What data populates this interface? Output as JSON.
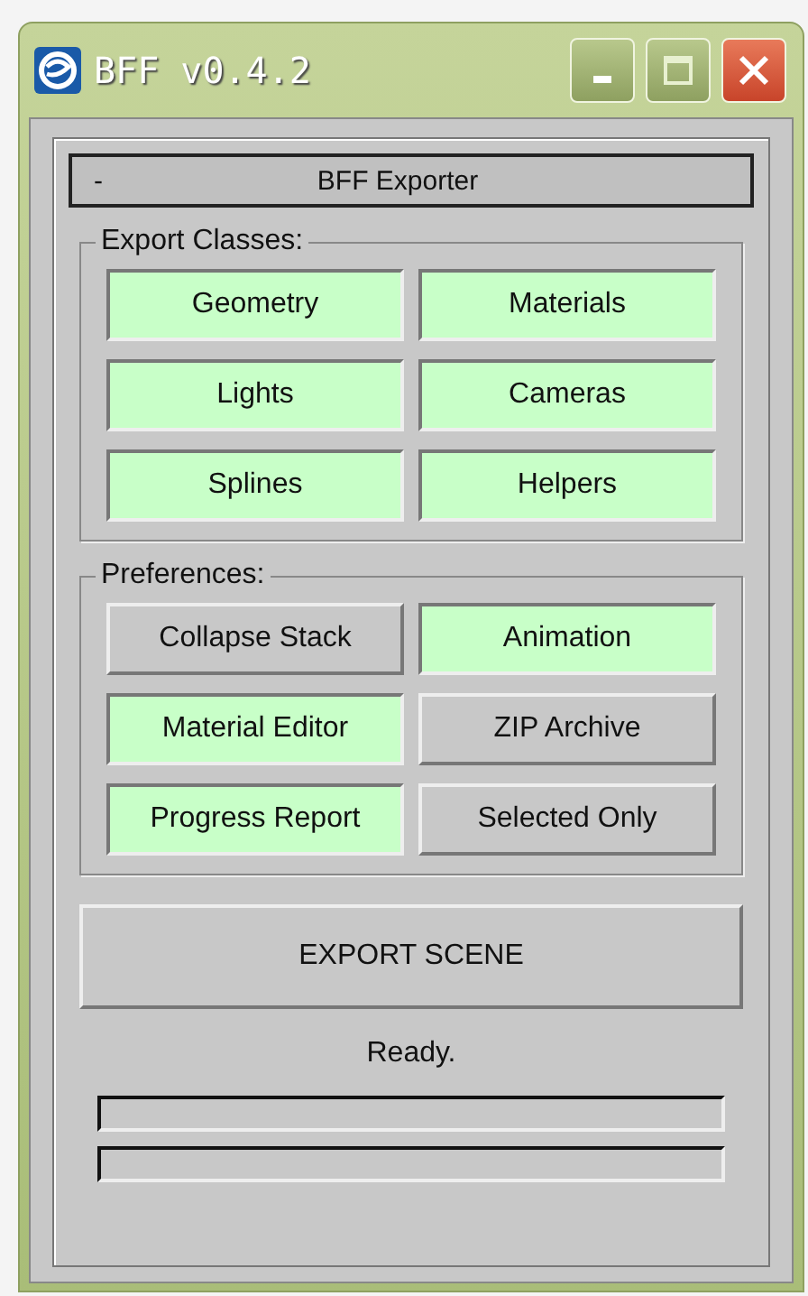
{
  "window": {
    "title": "BFF v0.4.2"
  },
  "rollout": {
    "toggle": "-",
    "title": "BFF Exporter"
  },
  "groups": [
    {
      "title": "Export Classes:",
      "buttons": [
        {
          "label": "Geometry",
          "on": true
        },
        {
          "label": "Materials",
          "on": true
        },
        {
          "label": "Lights",
          "on": true
        },
        {
          "label": "Cameras",
          "on": true
        },
        {
          "label": "Splines",
          "on": true
        },
        {
          "label": "Helpers",
          "on": true
        }
      ]
    },
    {
      "title": "Preferences:",
      "buttons": [
        {
          "label": "Collapse Stack",
          "on": false
        },
        {
          "label": "Animation",
          "on": true
        },
        {
          "label": "Material Editor",
          "on": true
        },
        {
          "label": "ZIP Archive",
          "on": false
        },
        {
          "label": "Progress Report",
          "on": true
        },
        {
          "label": "Selected Only",
          "on": false
        }
      ]
    }
  ],
  "export_button": "EXPORT SCENE",
  "status": "Ready.",
  "progress": [
    {
      "level": 0
    },
    {
      "level": 0
    }
  ]
}
